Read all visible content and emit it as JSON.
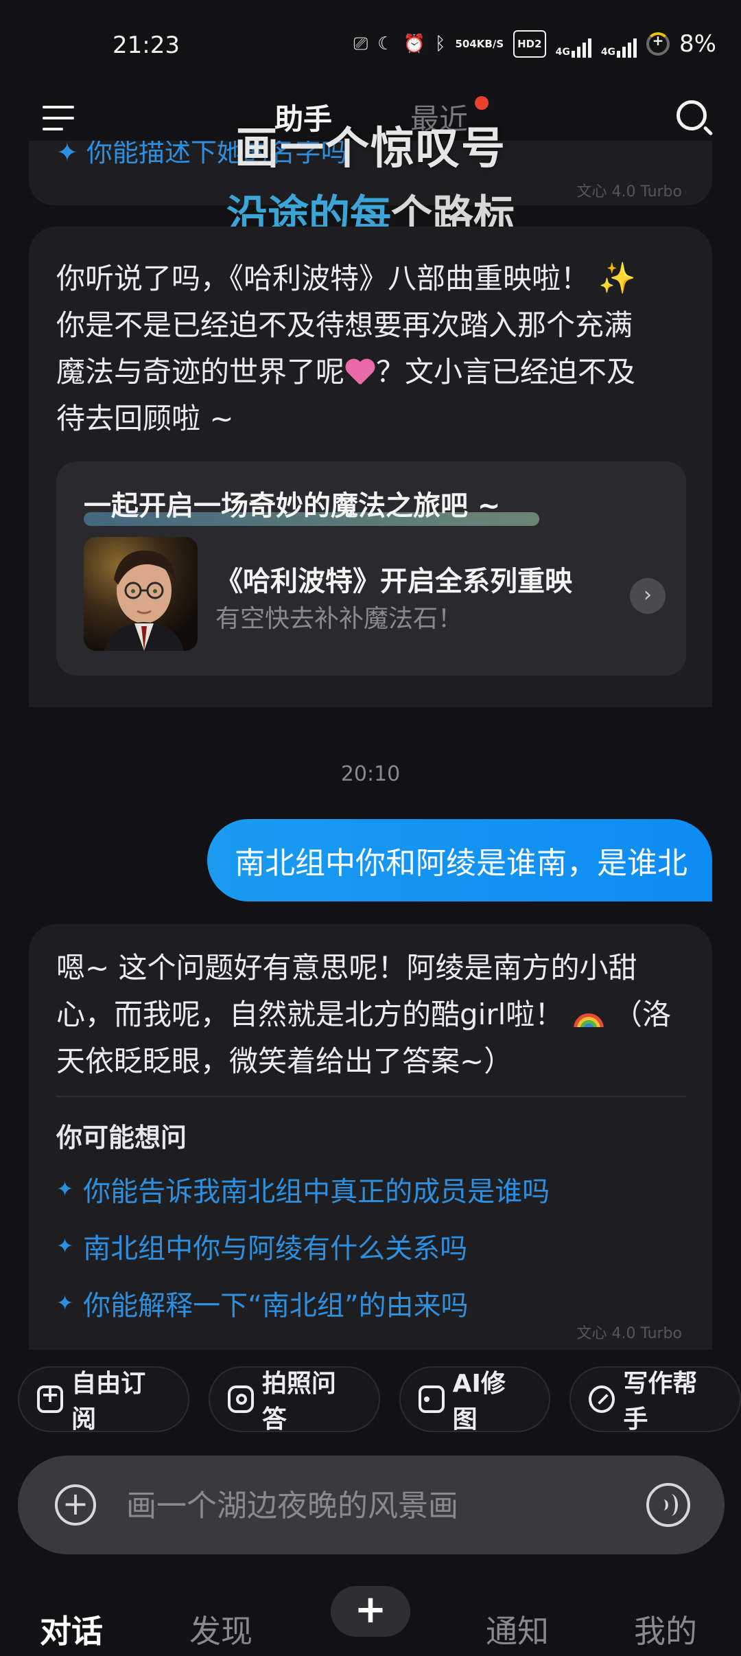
{
  "status_bar": {
    "time": "21:23",
    "speed_value": "504",
    "speed_unit": "KB/S",
    "hd_label": "HD2",
    "net1": "4G",
    "net2": "4G",
    "battery": "8%"
  },
  "header": {
    "tab_assistant": "助手",
    "tab_recent": "最近"
  },
  "banner": {
    "line1": "画一个惊叹号",
    "line2_highlight": "沿途的每",
    "line2_rest": "个路标"
  },
  "previous_message": {
    "suggestion": "你能描述下她的名字吗",
    "model": "文心 4.0 Turbo"
  },
  "assistant_message_1": {
    "line1": "你听说了吗，《哈利波特》八部曲重映啦！",
    "line2": "你是不是已经迫不及待想要再次踏入那个充满",
    "line3a": "魔法与奇迹的世界了呢",
    "line3b": "？文小言已经迫不及",
    "line4": "待去回顾啦 ~",
    "promo": {
      "title": "一起开启一场奇妙的魔法之旅吧 ~",
      "main": "《哈利波特》开启全系列重映",
      "sub": "有空快去补补魔法石！"
    }
  },
  "timestamp": "20:10",
  "user_message": "南北组中你和阿绫是谁南，是谁北",
  "assistant_message_2": {
    "line1": "嗯~ 这个问题好有意思呢！阿绫是南方的小甜",
    "line2a": "心，而我呢，自然就是北方的酷girl啦！",
    "line2b": "（洛",
    "line3": "天依眨眨眼，微笑着给出了答案~）",
    "suggest_title": "你可能想问",
    "suggestions": [
      "你能告诉我南北组中真正的成员是谁吗",
      "南北组中你与阿绫有什么关系吗",
      "你能解释一下“南北组”的由来吗"
    ],
    "model": "文心 4.0 Turbo"
  },
  "chips": [
    "自由订阅",
    "拍照问答",
    "AI修图",
    "写作帮手"
  ],
  "input": {
    "placeholder": "画一个湖边夜晚的风景画"
  },
  "bottom_nav": {
    "chat": "对话",
    "discover": "发现",
    "plus": "+",
    "notify": "通知",
    "mine": "我的"
  },
  "icons": {
    "menu": "menu-icon",
    "search": "search-icon",
    "attach": "plus-circle-icon",
    "voice": "voice-icon",
    "sparkle": "sparkles-emoji",
    "heart": "sparkling-heart-emoji",
    "rainbow": "rainbow-emoji"
  },
  "colors": {
    "background": "#121214",
    "card": "#1E1E21",
    "accent_blue": "#2D8FE0",
    "user_bubble": "#1A9BF0",
    "notify_dot": "#E8412F"
  }
}
